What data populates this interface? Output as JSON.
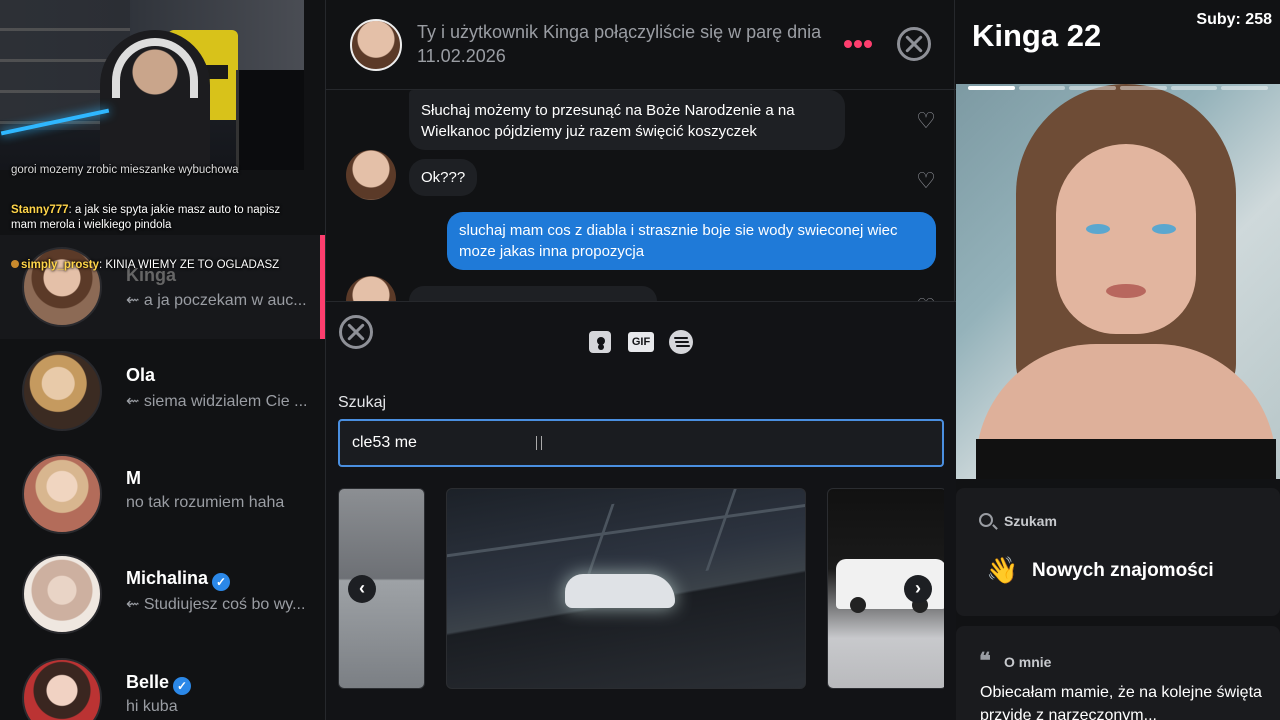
{
  "stream_chat": [
    {
      "user": "",
      "text": "goroi mozemy zrobic mieszanke wybuchowa"
    },
    {
      "user": "Stanny777",
      "text": "a jak sie spyta jakie masz auto to napisz mam merola i wielkiego pindola"
    },
    {
      "user": "simply_prosty",
      "text": "KINIA WIEMY ZE TO OGLADASZ"
    }
  ],
  "conversations": [
    {
      "name": "Kinga",
      "preview": "a ja poczekam w auc...",
      "reply_icon": "⇜",
      "verified": false,
      "selected": true
    },
    {
      "name": "Ola",
      "preview": "siema widzialem Cie ...",
      "reply_icon": "⇜",
      "verified": false
    },
    {
      "name": "M",
      "preview": "no tak rozumiem haha",
      "reply_icon": "",
      "verified": false
    },
    {
      "name": "Michalina",
      "preview": "Studiujesz coś bo wy...",
      "reply_icon": "⇜",
      "verified": true
    },
    {
      "name": "Belle",
      "preview": "hi kuba",
      "reply_icon": "",
      "verified": true
    }
  ],
  "chat_header": {
    "match_text": "Ty i użytkownik Kinga połączyliście się w parę dnia 11.02.2026"
  },
  "messages": [
    {
      "direction": "in",
      "text": "Słuchaj możemy to przesunąć na Boże Narodzenie a na Wielkanoc pójdziemy już razem święcić koszyczek"
    },
    {
      "direction": "in",
      "text": "Ok???"
    },
    {
      "direction": "out",
      "text": "sluchaj mam cos z diabla i strasznie boje sie wody swieconej wiec moze jakas inna propozycja"
    }
  ],
  "composer": {
    "tool_gif_label": "GIF",
    "search_label": "Szukaj",
    "search_value": "cle53 me"
  },
  "profile": {
    "name_age": "Kinga 22",
    "subs": "Suby: 258",
    "photo_count": 6,
    "seeking_title": "Szukam",
    "seeking_value": "Nowych znajomości",
    "about_title": "O mnie",
    "about_text": "Obiecałam mamie, że na kolejne święta przyjdę z narzeczonym..."
  },
  "colors": {
    "accent": "#fd3e6e",
    "outgoing_bubble": "#1f7ad8",
    "input_border": "#4a8fe0",
    "verified": "#2b88e8"
  },
  "icons": [
    "more-dots-icon",
    "close-circle-icon",
    "heart-icon",
    "contact-card-icon",
    "gif-icon",
    "spotify-icon",
    "chevron-left-icon",
    "chevron-right-icon",
    "search-icon",
    "wave-icon",
    "quote-icon",
    "verified-icon",
    "reply-arrow-icon"
  ]
}
